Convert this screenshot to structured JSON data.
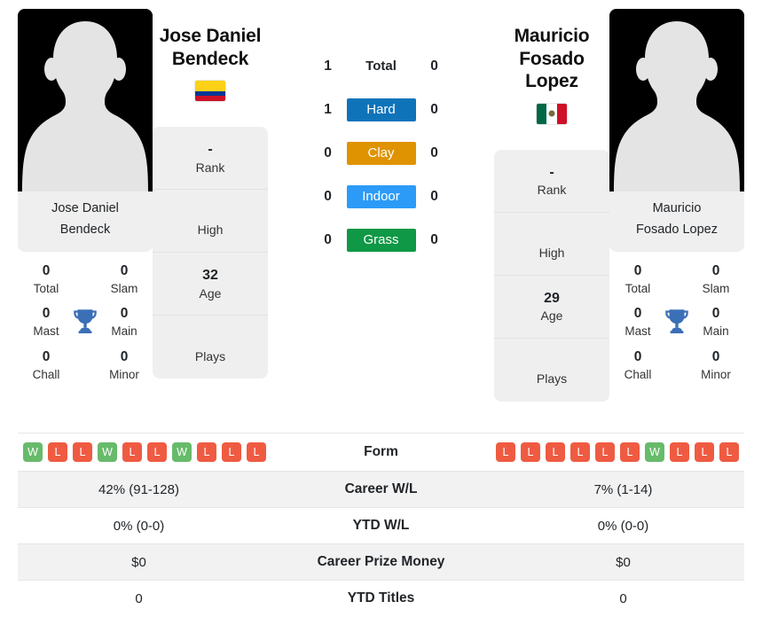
{
  "players": {
    "left": {
      "name_line1": "Jose Daniel",
      "name_line2": "Bendeck",
      "full_name": "Jose Daniel Bendeck",
      "photo_caption_line1": "Jose Daniel",
      "photo_caption_line2": "Bendeck",
      "flag_country": "Colombia",
      "flag_colors": [
        "#fcd116",
        "#003893",
        "#ce1126"
      ],
      "rank": "-",
      "rank_label": "Rank",
      "high": "",
      "high_label": "High",
      "age": "32",
      "age_label": "Age",
      "plays": "",
      "plays_label": "Plays",
      "titles": {
        "total": "0",
        "total_label": "Total",
        "slam": "0",
        "slam_label": "Slam",
        "mast": "0",
        "mast_label": "Mast",
        "main": "0",
        "main_label": "Main",
        "chall": "0",
        "chall_label": "Chall",
        "minor": "0",
        "minor_label": "Minor"
      },
      "form": [
        "W",
        "L",
        "L",
        "W",
        "L",
        "L",
        "W",
        "L",
        "L",
        "L"
      ],
      "career_wl": "42% (91-128)",
      "ytd_wl": "0% (0-0)",
      "career_prize_money": "$0",
      "ytd_titles": "0"
    },
    "right": {
      "name_line1": "Mauricio",
      "name_line2": "Fosado Lopez",
      "full_name": "Mauricio Fosado Lopez",
      "photo_caption_line1": "Mauricio",
      "photo_caption_line2": "Fosado Lopez",
      "flag_country": "Mexico",
      "flag_colors": [
        "#006847",
        "#ffffff",
        "#ce1126"
      ],
      "rank": "-",
      "rank_label": "Rank",
      "high": "",
      "high_label": "High",
      "age": "29",
      "age_label": "Age",
      "plays": "",
      "plays_label": "Plays",
      "titles": {
        "total": "0",
        "total_label": "Total",
        "slam": "0",
        "slam_label": "Slam",
        "mast": "0",
        "mast_label": "Mast",
        "main": "0",
        "main_label": "Main",
        "chall": "0",
        "chall_label": "Chall",
        "minor": "0",
        "minor_label": "Minor"
      },
      "form": [
        "L",
        "L",
        "L",
        "L",
        "L",
        "L",
        "W",
        "L",
        "L",
        "L"
      ],
      "career_wl": "7% (1-14)",
      "ytd_wl": "0% (0-0)",
      "career_prize_money": "$0",
      "ytd_titles": "0"
    }
  },
  "head_to_head": {
    "rows": [
      {
        "label": "Total",
        "left": "1",
        "right": "0",
        "color": "",
        "plain": true
      },
      {
        "label": "Hard",
        "left": "1",
        "right": "0",
        "color": "#0f73ba",
        "plain": false
      },
      {
        "label": "Clay",
        "left": "0",
        "right": "0",
        "color": "#e09300",
        "plain": false
      },
      {
        "label": "Indoor",
        "left": "0",
        "right": "0",
        "color": "#2c9bf7",
        "plain": false
      },
      {
        "label": "Grass",
        "left": "0",
        "right": "0",
        "color": "#0f9845",
        "plain": false
      }
    ]
  },
  "comparison_table": {
    "rows": [
      {
        "label": "Form",
        "type": "form",
        "shaded": false
      },
      {
        "label": "Career W/L",
        "type": "text",
        "shaded": true,
        "left": "42% (91-128)",
        "right": "7% (1-14)"
      },
      {
        "label": "YTD W/L",
        "type": "text",
        "shaded": false,
        "left": "0% (0-0)",
        "right": "0% (0-0)"
      },
      {
        "label": "Career Prize Money",
        "type": "text",
        "shaded": true,
        "left": "$0",
        "right": "$0"
      },
      {
        "label": "YTD Titles",
        "type": "text",
        "shaded": false,
        "left": "0",
        "right": "0"
      }
    ]
  },
  "theme": {
    "win_color": "#67bb6a",
    "loss_color": "#ef5b42",
    "trophy_color": "#3b6fb6",
    "card_bg": "#efefef",
    "row_shade": "#f2f2f2"
  }
}
